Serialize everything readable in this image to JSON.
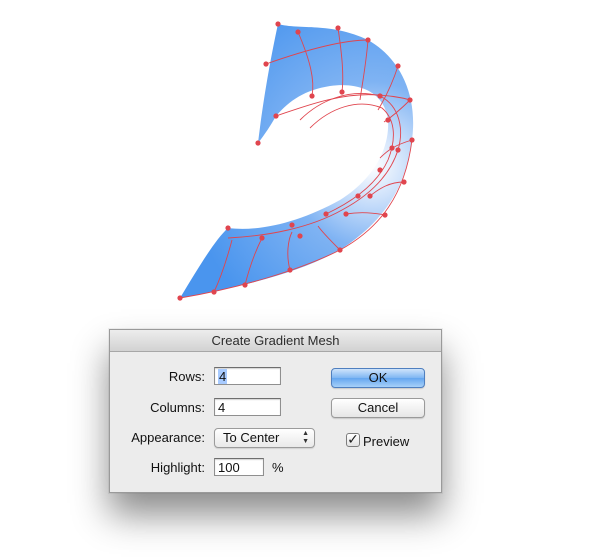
{
  "dialog": {
    "title": "Create Gradient Mesh",
    "rows": {
      "label": "Rows:",
      "value": "4"
    },
    "columns": {
      "label": "Columns:",
      "value": "4"
    },
    "appearance": {
      "label": "Appearance:",
      "value": "To Center",
      "arrows_icon": "up-down-arrows-icon"
    },
    "highlight": {
      "label": "Highlight:",
      "value": "100",
      "unit": "%"
    },
    "ok_label": "OK",
    "cancel_label": "Cancel",
    "preview": {
      "label": "Preview",
      "checked": true,
      "check_glyph": "✓"
    }
  },
  "colors": {
    "mesh_fill": "#4a95ee",
    "mesh_highlight": "#ffffff",
    "mesh_lines": "#e0454e",
    "ok_button": "#72adf2"
  }
}
